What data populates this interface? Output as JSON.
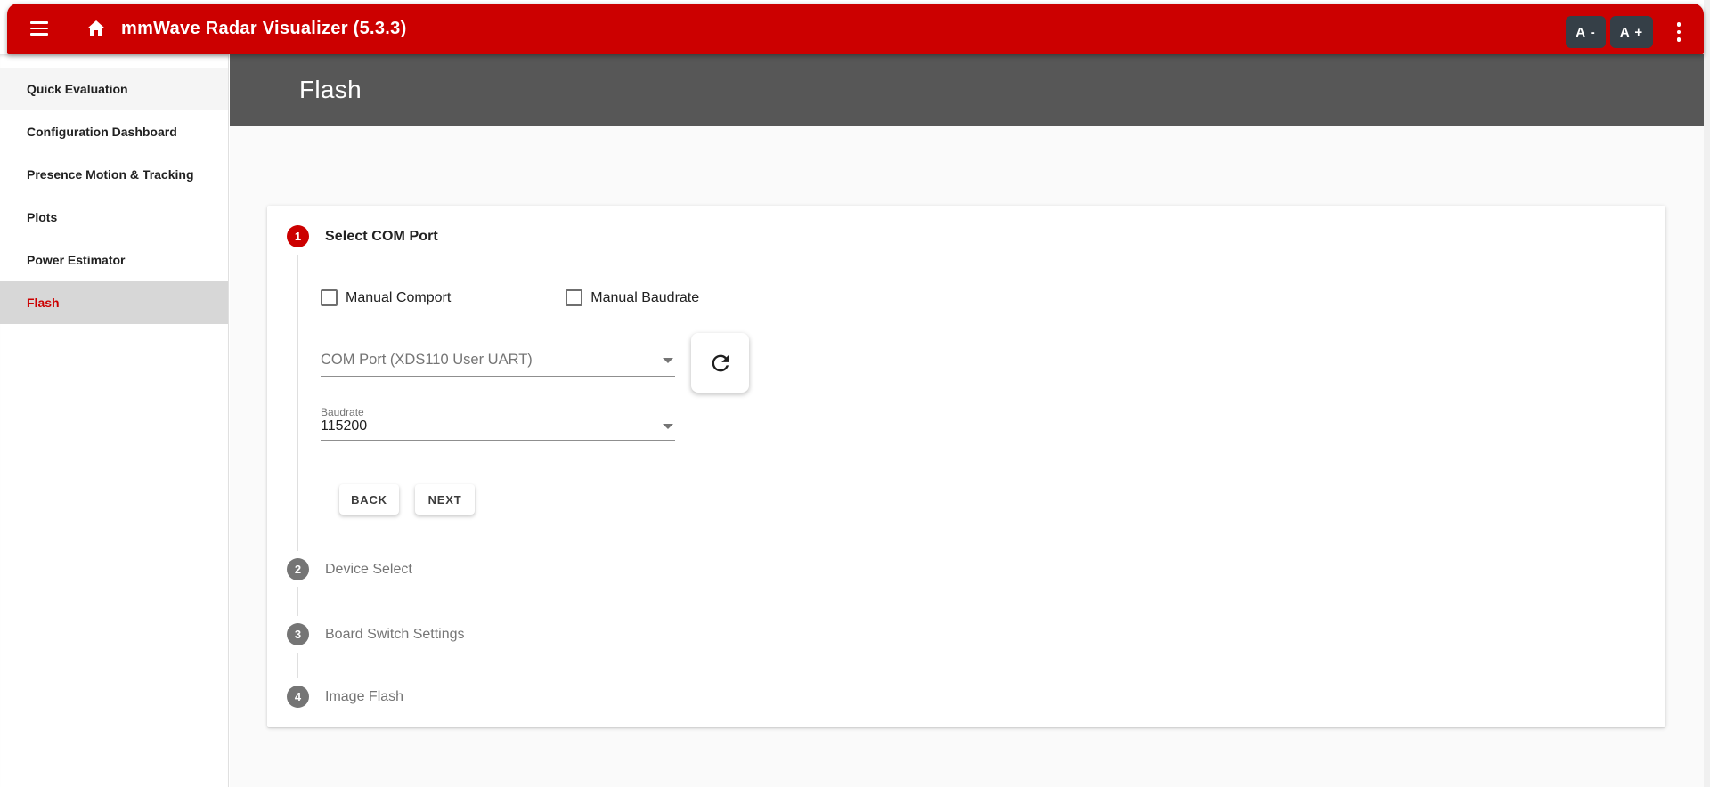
{
  "appbar": {
    "title": "mmWave Radar Visualizer (5.3.3)",
    "font_decrease_label": "A -",
    "font_increase_label": "A +"
  },
  "sidebar": {
    "items": [
      {
        "label": "Quick Evaluation",
        "active": false
      },
      {
        "label": "Configuration Dashboard",
        "active": false
      },
      {
        "label": "Presence Motion & Tracking",
        "active": false
      },
      {
        "label": "Plots",
        "active": false
      },
      {
        "label": "Power Estimator",
        "active": false
      },
      {
        "label": "Flash",
        "active": true
      }
    ]
  },
  "page": {
    "title": "Flash"
  },
  "stepper": {
    "steps": [
      {
        "num": "1",
        "label": "Select COM Port",
        "state": "active"
      },
      {
        "num": "2",
        "label": "Device Select",
        "state": "inactive"
      },
      {
        "num": "3",
        "label": "Board Switch Settings",
        "state": "inactive"
      },
      {
        "num": "4",
        "label": "Image Flash",
        "state": "inactive"
      }
    ],
    "step1": {
      "checkboxes": [
        {
          "label": "Manual Comport",
          "checked": false
        },
        {
          "label": "Manual Baudrate",
          "checked": false
        }
      ],
      "com_port": {
        "placeholder": "COM Port (XDS110 User UART)"
      },
      "baudrate": {
        "label": "Baudrate",
        "value": "115200"
      },
      "back_label": "BACK",
      "next_label": "NEXT"
    }
  },
  "colors": {
    "accent_red": "#cc0000",
    "page_header_bg": "#575757",
    "dark_button_bg": "#353f47",
    "inactive_step_gray": "#757575",
    "active_sidebar_bg": "#d7d7d7",
    "content_bg": "#fafafa"
  },
  "icons": {
    "menu": "menu-icon",
    "home": "home-icon",
    "more": "kebab-menu-icon",
    "refresh": "refresh-icon",
    "dropdown": "dropdown-arrow-icon"
  }
}
